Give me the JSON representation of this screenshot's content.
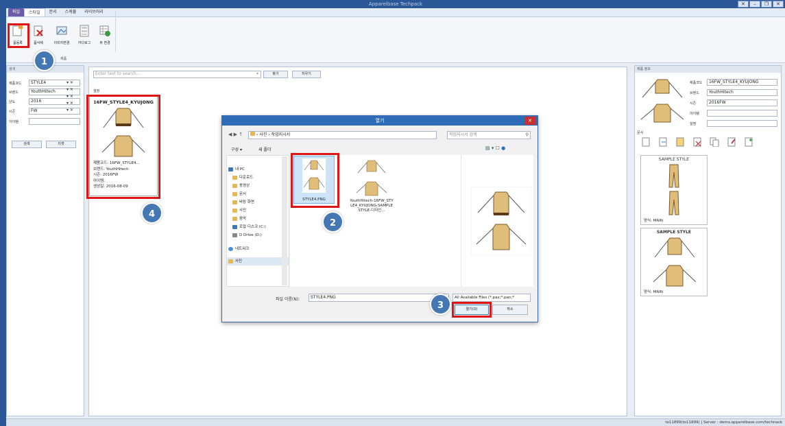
{
  "app": {
    "title": "Apparelbase Techpack"
  },
  "window_controls": [
    "✕",
    "–",
    "❐",
    "✕"
  ],
  "ribbon": {
    "tabs": [
      "파일",
      "스타일",
      "문서",
      "스케쥴",
      "라이브러리"
    ],
    "buttons": [
      "품등록",
      "품삭제",
      "이미지변경",
      "카다로그",
      "뷰 변경"
    ],
    "group_name": "제품"
  },
  "search_panel": {
    "header": "검색",
    "fields": [
      {
        "label": "제품코드",
        "value": "STYLE4"
      },
      {
        "label": "브랜드",
        "value": "YouthHitech"
      },
      {
        "label": "년도",
        "value": "2016"
      },
      {
        "label": "시즌",
        "value": "FW"
      },
      {
        "label": "아이템",
        "value": ""
      }
    ],
    "search_button": "검색",
    "reset_button": "리셋"
  },
  "center": {
    "search_placeholder": "Enter text to search...",
    "find_button": "찾기",
    "clear_button": "지우기",
    "group_label": "설정",
    "card": {
      "title": "16FW_STYLE4_KYUJONG",
      "rows": [
        {
          "label": "제품코드:",
          "value": "16FW_STYLE4..."
        },
        {
          "label": "브랜드:",
          "value": "YouthHitech"
        },
        {
          "label": "시즌:",
          "value": "2016FW"
        },
        {
          "label": "아이템:",
          "value": ""
        },
        {
          "label": "생성일:",
          "value": "2016-08-09"
        }
      ]
    }
  },
  "dialog": {
    "title": "열기",
    "path": "› 사진 › 작업지시서",
    "search_placeholder": "작업지시서 검색",
    "organize": "구성 ▾",
    "new_folder": "새 폴더",
    "nav": [
      "내 PC",
      "다운로드",
      "동영상",
      "문서",
      "바탕 화면",
      "사진",
      "음악",
      "로컬 디스크 (C:)",
      "D Drive (D:)",
      "네트워크",
      "사진"
    ],
    "files": [
      {
        "name": "STYLE4.PNG"
      },
      {
        "name": "YouthHitech-16FW_STYLE4_KYUJONG-SAMPLE STYLE-디자인..."
      }
    ],
    "filename_label": "파일 이름(N):",
    "filename_value": "STYLE4.PNG",
    "filter": "All Available Files (*.pax;*.pan;*",
    "open_button": "열기(O)",
    "cancel_button": "취소"
  },
  "right_panel": {
    "header": "제품 정보",
    "fields": [
      {
        "label": "제품코드",
        "value": "16FW_STYLE4_KYUJONG"
      },
      {
        "label": "브랜드",
        "value": "YouthHitech"
      },
      {
        "label": "시즌",
        "value": "2016FW"
      },
      {
        "label": "아이템",
        "value": ""
      },
      {
        "label": "설명",
        "value": ""
      }
    ],
    "docs_label": "문서",
    "cards": [
      {
        "title": "SAMPLE STYLE",
        "caption_label": "양식:",
        "caption_value": "MAIN"
      },
      {
        "title": "SAMPLE STYLE",
        "caption_label": "양식:",
        "caption_value": "MAIN"
      }
    ]
  },
  "badges": [
    "1",
    "2",
    "3",
    "4"
  ],
  "status": {
    "text": "to11899(to11899) | Server : demo.apparelbase.com/technack"
  },
  "colors": {
    "highlight": "#e01414",
    "badge": "#4578b3",
    "title_bar": "#2b5797",
    "dialog_title": "#2f6cb7"
  }
}
